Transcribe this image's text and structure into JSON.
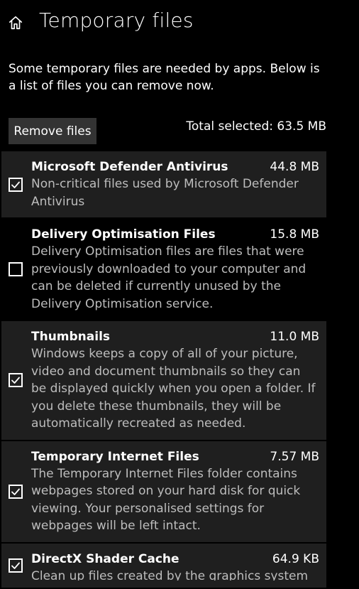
{
  "header": {
    "title": "Temporary files",
    "home_icon": "home-icon"
  },
  "intro": {
    "text": "Some temporary files are needed by apps. Below is a list of files you can remove now."
  },
  "actions": {
    "remove_label": "Remove files",
    "total_label": "Total selected: 63.5 MB"
  },
  "items": [
    {
      "name": "Microsoft Defender Antivirus",
      "size": "44.8 MB",
      "description": "Non-critical files used by Microsoft Defender Antivirus",
      "checked": true
    },
    {
      "name": "Delivery Optimisation Files",
      "size": "15.8 MB",
      "description": "Delivery Optimisation files are files that were previously downloaded to your computer and can be deleted if currently unused by the Delivery Optimisation service.",
      "checked": false
    },
    {
      "name": "Thumbnails",
      "size": "11.0 MB",
      "description": "Windows keeps a copy of all of your picture, video and document thumbnails so they can be displayed quickly when you open a folder. If you delete these thumbnails, they will be automatically recreated as needed.",
      "checked": true
    },
    {
      "name": "Temporary Internet Files",
      "size": "7.57 MB",
      "description": "The Temporary Internet Files folder contains webpages stored on your hard disk for quick viewing. Your personalised settings for webpages will be left intact.",
      "checked": true
    },
    {
      "name": "DirectX Shader Cache",
      "size": "64.9 KB",
      "description": "Clean up files created by the graphics system",
      "checked": true
    }
  ],
  "colors": {
    "background": "#000000",
    "selected_row": "#1f1f1f",
    "button": "#333333",
    "secondary_text": "#bdbdbd"
  }
}
